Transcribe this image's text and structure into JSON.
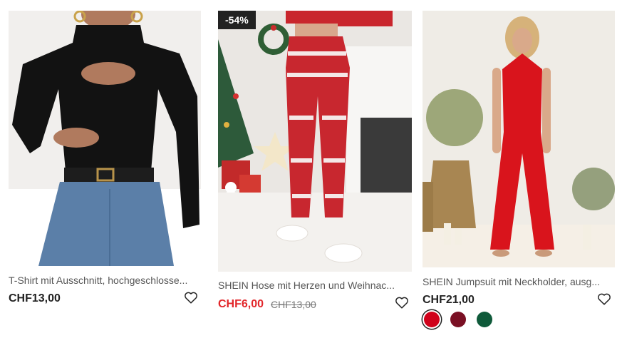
{
  "products": [
    {
      "title": "T-Shirt mit Ausschnitt, hochgeschlosse...",
      "price": "CHF13,00",
      "image": "black-cutout-top-model"
    },
    {
      "badge": "-54%",
      "title": "SHEIN Hose mit Herzen und Weihnac...",
      "price": "CHF6,00",
      "original_price": "CHF13,00",
      "image": "christmas-print-pants-model"
    },
    {
      "title": "SHEIN Jumpsuit mit Neckholder, ausg...",
      "price": "CHF21,00",
      "image": "red-halter-jumpsuit-model",
      "swatches": [
        "#d0021b",
        "#7a1024",
        "#0f5a3a"
      ]
    }
  ],
  "icons": {
    "wishlist": "heart-outline-icon"
  },
  "colors": {
    "sale": "#e2262a",
    "badge_bg": "#222222"
  }
}
